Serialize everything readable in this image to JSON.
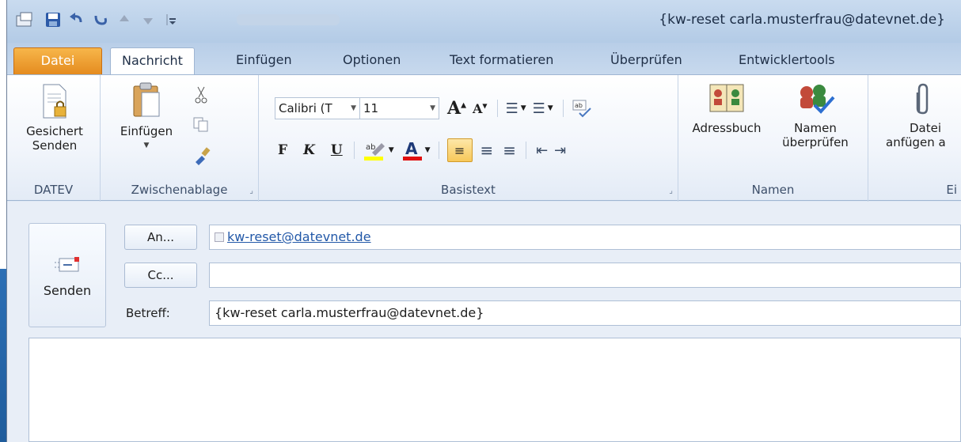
{
  "window": {
    "title": "{kw-reset carla.musterfrau@datevnet.de}"
  },
  "tabs": [
    {
      "label": "Datei"
    },
    {
      "label": "Nachricht"
    },
    {
      "label": "Einfügen"
    },
    {
      "label": "Optionen"
    },
    {
      "label": "Text formatieren"
    },
    {
      "label": "Überprüfen"
    },
    {
      "label": "Entwicklertools"
    }
  ],
  "ribbon": {
    "datev": {
      "button_line1": "Gesichert",
      "button_line2": "Senden",
      "label": "DATEV"
    },
    "clipboard": {
      "paste_label": "Einfügen",
      "label": "Zwischenablage"
    },
    "basictext": {
      "font_name": "Calibri (T",
      "font_size": "11",
      "bold": "F",
      "italic": "K",
      "underline": "U",
      "label": "Basistext"
    },
    "names": {
      "addressbook": "Adressbuch",
      "check_line1": "Namen",
      "check_line2": "überprüfen",
      "label": "Namen"
    },
    "include": {
      "attach_line1": "Datei",
      "attach_line2": "anfügen a",
      "label": "Ei"
    }
  },
  "compose": {
    "send_label": "Senden",
    "to_button": "An...",
    "cc_button": "Cc...",
    "subject_label": "Betreff:",
    "to_value": "kw-reset@datevnet.de",
    "cc_value": "",
    "subject_value": "{kw-reset carla.musterfrau@datevnet.de}"
  },
  "colors": {
    "accent_orange": "#e2861a",
    "highlight_yellow": "#ffff00",
    "font_color_red": "#e01010",
    "link_blue": "#2258a8"
  }
}
